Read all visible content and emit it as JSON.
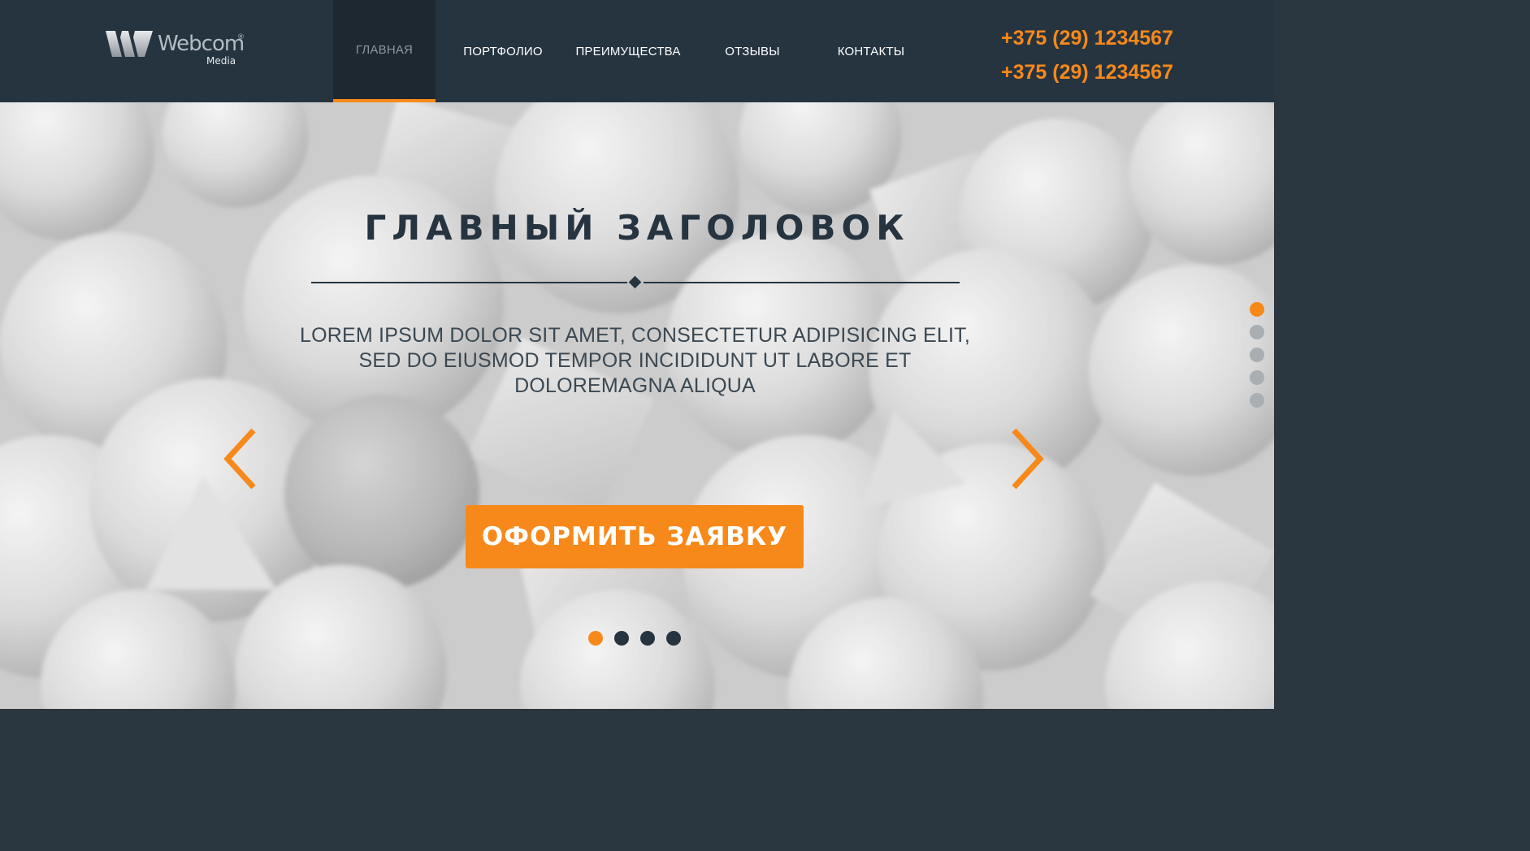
{
  "brand": {
    "name": "Webcom",
    "sub": "Media",
    "reg": "®"
  },
  "nav": {
    "items": [
      {
        "label": "ГЛАВНАЯ",
        "active": true
      },
      {
        "label": "ПОРТФОЛИО",
        "active": false
      },
      {
        "label": "ПРЕИМУЩЕСТВА",
        "active": false
      },
      {
        "label": "ОТЗЫВЫ",
        "active": false
      },
      {
        "label": "КОНТАКТЫ",
        "active": false
      }
    ]
  },
  "contacts": {
    "phones": [
      "+375 (29) 1234567",
      "+375 (29) 1234567"
    ]
  },
  "hero": {
    "title": "ГЛАВНЫЙ ЗАГОЛОВОК",
    "text": "LOREM IPSUM DOLOR SIT AMET, CONSECTETUR ADIPISICING ELIT, SED DO EIUSMOD TEMPOR INCIDIDUNT UT LABORE ET DOLOREMAGNA ALIQUA",
    "cta_label": "ОФОРМИТЬ ЗАЯВКУ",
    "slides_total": 4,
    "slide_active": 1,
    "sections_total": 5,
    "section_active": 1
  },
  "colors": {
    "accent": "#f7891a",
    "header_bg": "#263440",
    "active_nav_bg": "#1d2830",
    "title": "#263440"
  },
  "icons": {
    "prev": "chevron-left-icon",
    "next": "chevron-right-icon",
    "logo": "webcom-logo-icon"
  }
}
